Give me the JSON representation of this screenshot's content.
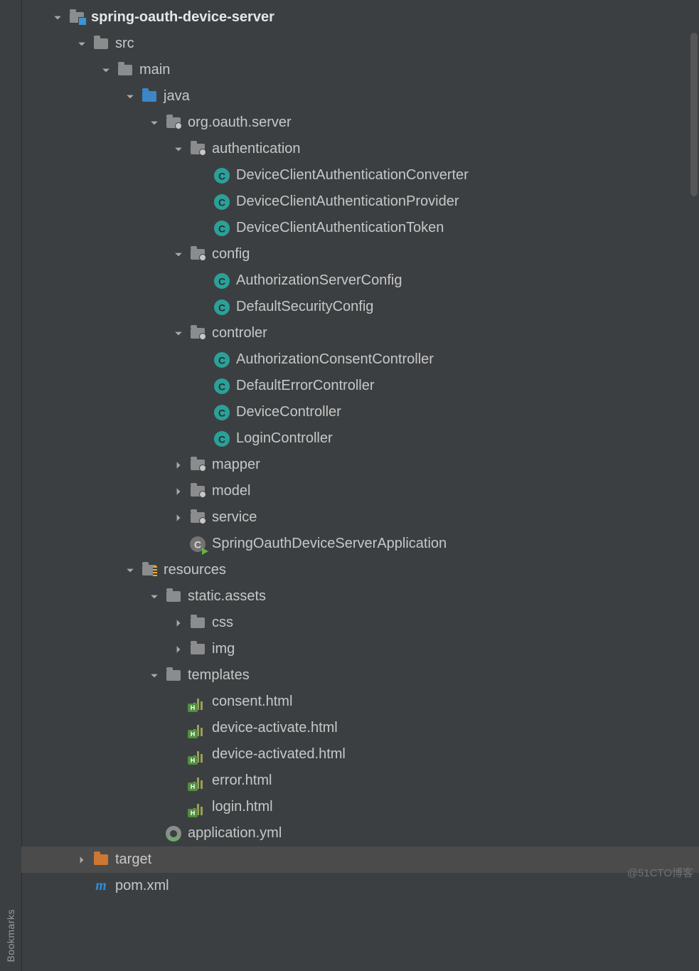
{
  "sidebar": {
    "label_bookmarks": "Bookmarks"
  },
  "watermark": "@51CTO博客",
  "tree": [
    {
      "depth": 0,
      "arrow": "down",
      "icon": "module",
      "label": "spring-oauth-device-server",
      "bold": true
    },
    {
      "depth": 1,
      "arrow": "down",
      "icon": "folder-grey",
      "label": "src"
    },
    {
      "depth": 2,
      "arrow": "down",
      "icon": "folder-grey",
      "label": "main"
    },
    {
      "depth": 3,
      "arrow": "down",
      "icon": "folder-blue",
      "label": "java"
    },
    {
      "depth": 4,
      "arrow": "down",
      "icon": "package",
      "label": "org.oauth.server"
    },
    {
      "depth": 5,
      "arrow": "down",
      "icon": "package",
      "label": "authentication"
    },
    {
      "depth": 6,
      "arrow": "none",
      "icon": "class",
      "label": "DeviceClientAuthenticationConverter"
    },
    {
      "depth": 6,
      "arrow": "none",
      "icon": "class",
      "label": "DeviceClientAuthenticationProvider"
    },
    {
      "depth": 6,
      "arrow": "none",
      "icon": "class",
      "label": "DeviceClientAuthenticationToken"
    },
    {
      "depth": 5,
      "arrow": "down",
      "icon": "package",
      "label": "config"
    },
    {
      "depth": 6,
      "arrow": "none",
      "icon": "class",
      "label": "AuthorizationServerConfig"
    },
    {
      "depth": 6,
      "arrow": "none",
      "icon": "class",
      "label": "DefaultSecurityConfig"
    },
    {
      "depth": 5,
      "arrow": "down",
      "icon": "package",
      "label": "controler"
    },
    {
      "depth": 6,
      "arrow": "none",
      "icon": "class",
      "label": "AuthorizationConsentController"
    },
    {
      "depth": 6,
      "arrow": "none",
      "icon": "class",
      "label": "DefaultErrorController"
    },
    {
      "depth": 6,
      "arrow": "none",
      "icon": "class",
      "label": "DeviceController"
    },
    {
      "depth": 6,
      "arrow": "none",
      "icon": "class",
      "label": "LoginController"
    },
    {
      "depth": 5,
      "arrow": "right",
      "icon": "package",
      "label": "mapper"
    },
    {
      "depth": 5,
      "arrow": "right",
      "icon": "package",
      "label": "model"
    },
    {
      "depth": 5,
      "arrow": "right",
      "icon": "package",
      "label": "service"
    },
    {
      "depth": 5,
      "arrow": "none",
      "icon": "class-run",
      "label": "SpringOauthDeviceServerApplication"
    },
    {
      "depth": 3,
      "arrow": "down",
      "icon": "resources",
      "label": "resources"
    },
    {
      "depth": 4,
      "arrow": "down",
      "icon": "folder-grey",
      "label": "static.assets"
    },
    {
      "depth": 5,
      "arrow": "right",
      "icon": "folder-grey",
      "label": "css"
    },
    {
      "depth": 5,
      "arrow": "right",
      "icon": "folder-grey",
      "label": "img"
    },
    {
      "depth": 4,
      "arrow": "down",
      "icon": "folder-grey",
      "label": "templates"
    },
    {
      "depth": 5,
      "arrow": "none",
      "icon": "html",
      "label": "consent.html"
    },
    {
      "depth": 5,
      "arrow": "none",
      "icon": "html",
      "label": "device-activate.html"
    },
    {
      "depth": 5,
      "arrow": "none",
      "icon": "html",
      "label": "device-activated.html"
    },
    {
      "depth": 5,
      "arrow": "none",
      "icon": "html",
      "label": "error.html"
    },
    {
      "depth": 5,
      "arrow": "none",
      "icon": "html",
      "label": "login.html"
    },
    {
      "depth": 4,
      "arrow": "none",
      "icon": "yml",
      "label": "application.yml"
    },
    {
      "depth": 1,
      "arrow": "right",
      "icon": "folder-brown",
      "label": "target",
      "selected": true
    },
    {
      "depth": 1,
      "arrow": "none",
      "icon": "pom",
      "label": "pom.xml"
    }
  ]
}
